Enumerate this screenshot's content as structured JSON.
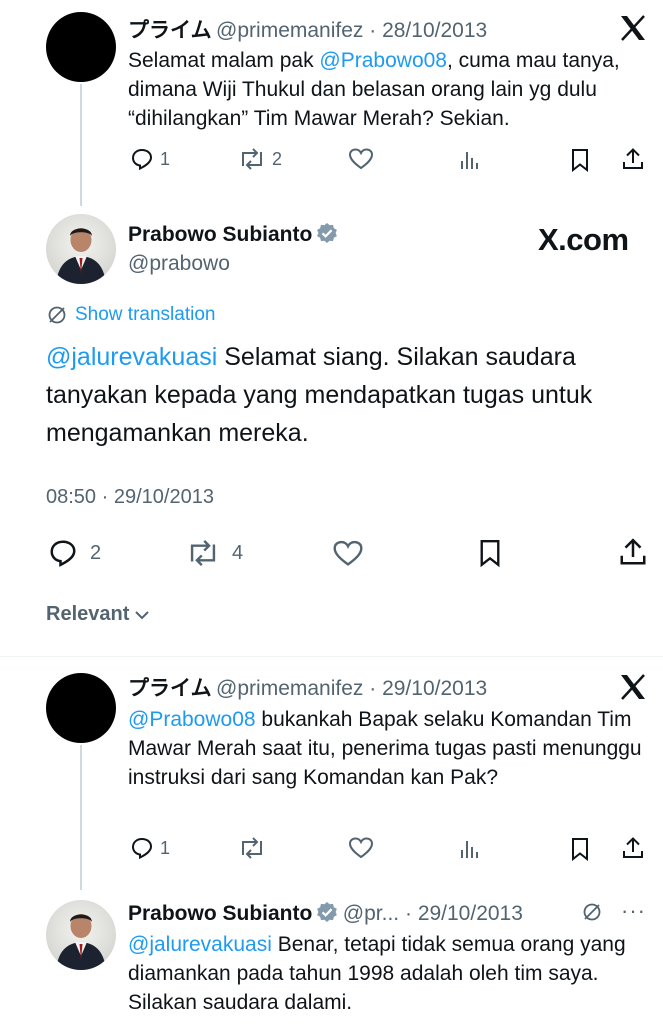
{
  "tweets": [
    {
      "name": "プライム",
      "handle": "@primemanifez",
      "sep": " · ",
      "date": "28/10/2013",
      "mention": "@Prabowo08",
      "text_before": "Selamat malam pak ",
      "text_after": ", cuma mau tanya, dimana Wiji Thukul dan belasan orang lain yg dulu “dihilangkan” Tim Mawar Merah? Sekian.",
      "replies": "1",
      "reposts": "2"
    },
    {
      "name": "Prabowo Subianto",
      "handle": "@prabowo",
      "brand": "X.com",
      "show_translation": "Show translation",
      "mention": "@jalurevakuasi",
      "text": " Selamat siang. Silakan saudara tanyakan kepada yang mendapatkan tugas untuk mengamankan mereka.",
      "time": "08:50",
      "sep": " · ",
      "date": "29/10/2013",
      "replies": "2",
      "reposts": "4"
    },
    {
      "name": "プライム",
      "handle": "@primemanifez",
      "sep": " · ",
      "date": "29/10/2013",
      "mention": "@Prabowo08",
      "text": " bukankah Bapak selaku Komandan Tim Mawar Merah saat itu, penerima tugas pasti menunggu instruksi dari sang Komandan kan Pak?",
      "replies": "1"
    },
    {
      "name": "Prabowo Subianto",
      "handle": "@pr...",
      "sep": " · ",
      "date": "29/10/2013",
      "more": "···",
      "mention": "@jalurevakuasi",
      "text": " Benar, tetapi tidak semua orang yang diamankan pada tahun 1998 adalah oleh tim saya. Silakan saudara dalami."
    }
  ],
  "sort": {
    "label": "Relevant"
  },
  "colors": {
    "mention": "#1d9bf0",
    "muted": "#536471",
    "text": "#0f1419",
    "verified": "#829aab"
  }
}
